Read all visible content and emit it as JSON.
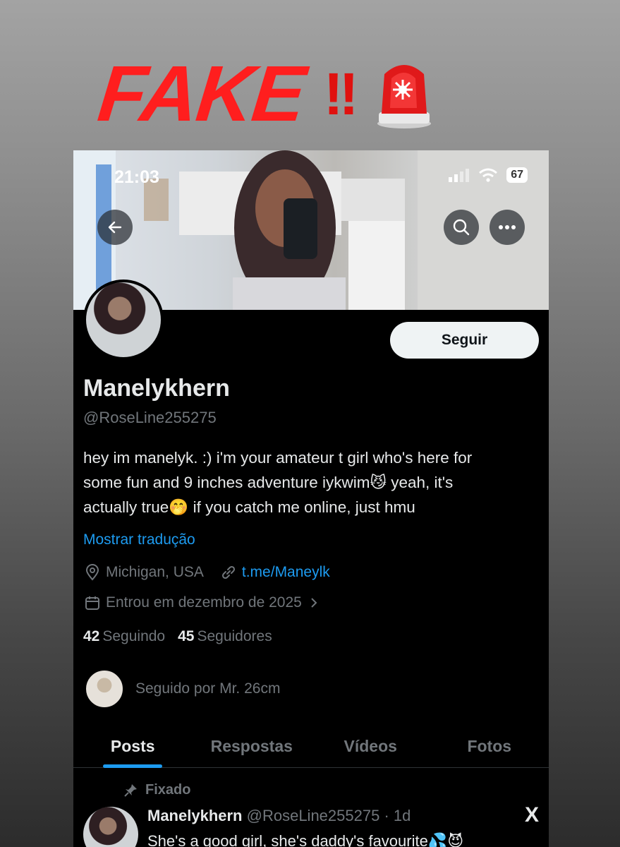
{
  "warning": {
    "title": "FAKE",
    "exclaim": "!!"
  },
  "status_bar": {
    "time": "21:03",
    "battery": "67"
  },
  "profile": {
    "follow_label": "Seguir",
    "name": "Manelykhern",
    "handle": "@RoseLine255275",
    "bio_line1": "hey im manelyk. :) i'm your amateur t girl who's here for",
    "bio_line2": "some fun and 9 inches adventure iykwim",
    "bio_emoji1": "😼",
    "bio_line2b": "yeah, it's",
    "bio_line3": "actually true",
    "bio_emoji2": "🤭",
    "bio_line3b": "if you catch me online, just hmu",
    "translate_label": "Mostrar tradução",
    "location": "Michigan, USA",
    "link": "t.me/Maneylk",
    "joined": "Entrou em dezembro de 2025",
    "following_count": "42",
    "following_label": "Seguindo",
    "followers_count": "45",
    "followers_label": "Seguidores",
    "followed_by": "Seguido por Mr. 26cm"
  },
  "tabs": [
    {
      "label": "Posts",
      "active": true
    },
    {
      "label": "Respostas",
      "active": false
    },
    {
      "label": "Vídeos",
      "active": false
    },
    {
      "label": "Fotos",
      "active": false
    }
  ],
  "post": {
    "pinned_label": "Fixado",
    "author": "Manelykhern",
    "handle": "@RoseLine255275",
    "time": "· 1d",
    "text": "She's a good girl, she's daddy's favourite",
    "emoji": "💦😈",
    "platform_icon": "X"
  },
  "colors": {
    "accent": "#1d9bf0",
    "warning_red": "#ff1e1e"
  }
}
